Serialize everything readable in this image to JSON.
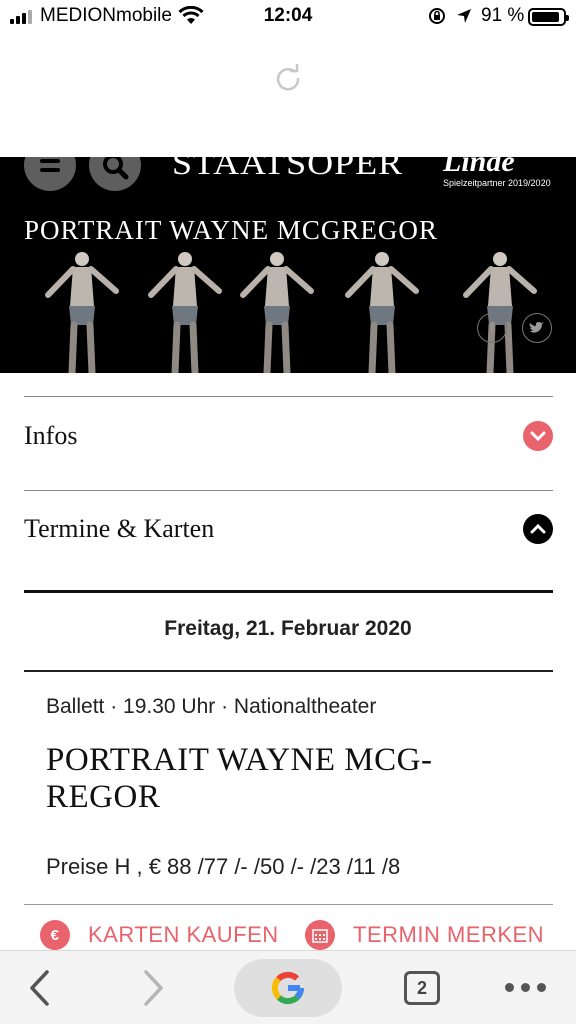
{
  "status": {
    "carrier": "MEDIONmobile",
    "time": "12:04",
    "battery": "91 %",
    "battery_level": 0.91,
    "signal_bars": 3,
    "signal_total": 4
  },
  "header": {
    "logo_text": "STAATSOPER",
    "sponsor_logo": "Linde",
    "sponsor_note": "Spielzeitpartner 2019/2020",
    "hero_title": "PORTRAIT WAYNE MCGREGOR",
    "hero_image": "five dancers on black stage"
  },
  "icons": {
    "menu": "menu-icon",
    "search": "search-icon",
    "facebook": "facebook-icon",
    "twitter": "twitter-icon",
    "reload": "reload-icon"
  },
  "accordion": {
    "infos_label": "Infos",
    "termine_label": "Termine & Karten"
  },
  "event": {
    "date": "Freitag, 21. Februar 2020",
    "meta": "Ballett · 19.30 Uhr · Nationaltheater",
    "title": "PORTRAIT WAYNE MCG-REGOR",
    "title_line1": "PORTRAIT WAYNE MCG-",
    "title_line2": "REGOR",
    "prices": "Preise H , € 88 /77 /- /50 /- /23 /11 /8"
  },
  "actions": {
    "buy_label": "KARTEN KAUFEN",
    "remember_label": "TERMIN MERKEN",
    "buy_icon_glyph": "€"
  },
  "browser": {
    "tab_count": "2"
  },
  "colors": {
    "accent": "#e8636b",
    "hero_bg": "#000000",
    "text": "#111111"
  }
}
